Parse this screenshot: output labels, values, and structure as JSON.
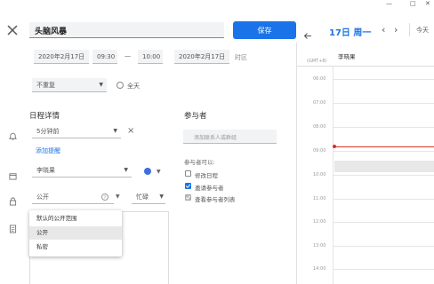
{
  "window": {
    "minimize_label": "—",
    "maximize_label": "□",
    "close_label": "✕"
  },
  "header": {
    "title_value": "头脑风暴",
    "save_label": "保存",
    "date_start": "2020年2月17日",
    "time_start": "09:30",
    "separator": "—",
    "time_end": "10:00",
    "date_end": "2020年2月17日",
    "timezone_label": "时区",
    "repeat_value": "不重复",
    "allday_label": "全天"
  },
  "details": {
    "section_title": "日程详情",
    "reminder_value": "5分钟前",
    "add_reminder_label": "添加提醒",
    "calendar_value": "李晓果",
    "calendar_color": "#3f6fd8",
    "visibility_value": "公开",
    "busy_value": "忙碌",
    "visibility_menu": {
      "options": [
        {
          "label": "默认的公开范围"
        },
        {
          "label": "公开"
        },
        {
          "label": "私密"
        }
      ]
    }
  },
  "guests": {
    "section_title": "参与者",
    "add_placeholder": "添加联系人或群组",
    "permissions_title": "参与者可以:",
    "permissions": [
      {
        "label": "修改日程",
        "checked": false
      },
      {
        "label": "邀请参与者",
        "checked": true
      },
      {
        "label": "查看参与者列表",
        "checked": true
      }
    ]
  },
  "day_view": {
    "nav_prev_icon": "arrow-left-icon",
    "date_title": "17日 周一",
    "prev_label": "‹",
    "next_label": "›",
    "today_label": "今天",
    "timezone": "GMT+8",
    "calendar_owner": "李晓果",
    "hours": [
      "06:00",
      "07:00",
      "08:00",
      "09:00",
      "10:00",
      "11:00",
      "12:00",
      "13:00",
      "14:00"
    ],
    "current_time_color": "#d93025",
    "event_color": "#e8e8e8"
  }
}
